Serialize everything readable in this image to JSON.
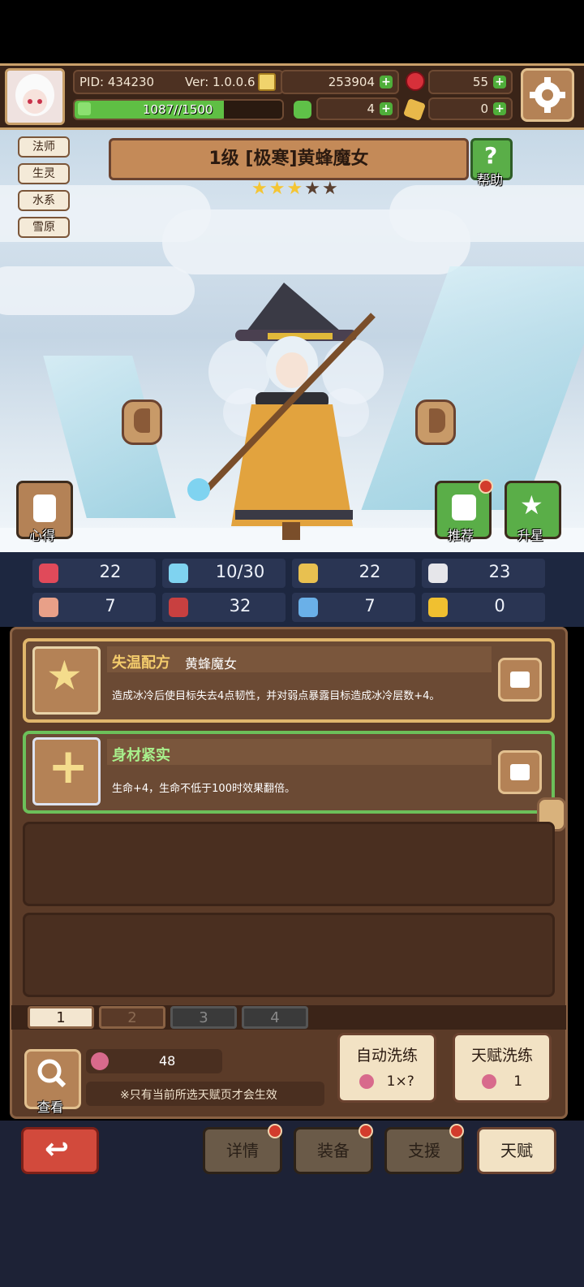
{
  "header": {
    "pid": "PID: 434230",
    "version": "Ver: 1.0.0.6",
    "gold": "253904",
    "gems": "55",
    "clover": "4",
    "dice": "0",
    "exp_text": "1087//1500",
    "exp_fraction": 0.72
  },
  "tags": [
    "法师",
    "生灵",
    "水系",
    "雪原"
  ],
  "title": {
    "name": "1级 [极寒]黄蜂魔女",
    "stars_filled": 3,
    "stars_total": 5,
    "help_label": "帮助"
  },
  "side_buttons": {
    "insight": "心得",
    "recommend": "推荐",
    "star_up": "升星"
  },
  "stats": [
    {
      "icon": "heart-icon",
      "value": "22"
    },
    {
      "icon": "mana-drop-icon",
      "value": "10/30"
    },
    {
      "icon": "shield-icon",
      "value": "22"
    },
    {
      "icon": "wing-icon",
      "value": "23"
    },
    {
      "icon": "fist-icon",
      "value": "7"
    },
    {
      "icon": "book-icon",
      "value": "32"
    },
    {
      "icon": "boot-icon",
      "value": "7"
    },
    {
      "icon": "horseshoe-icon",
      "value": "0"
    }
  ],
  "talents": [
    {
      "name": "失温配方",
      "owner": "黄蜂魔女",
      "description": "造成冰冷后使目标失去4点韧性，并对弱点暴露目标造成冰冷层数+4。"
    },
    {
      "name": "身材紧实",
      "owner": "",
      "description": "生命+4，生命不低于100时效果翻倍。"
    }
  ],
  "pages": [
    "1",
    "2",
    "3",
    "4"
  ],
  "potion_count": "48",
  "notice": "※只有当前所选天赋页才会生效",
  "view_label": "查看",
  "auto_refine": {
    "label": "自动洗练",
    "cost": "1×?"
  },
  "talent_refine": {
    "label": "天赋洗练",
    "cost": "1"
  },
  "nav": [
    "详情",
    "装备",
    "支援",
    "天赋"
  ],
  "colors": {
    "accent_gold": "#c9a06a",
    "green": "#4fae3a",
    "red_dot": "#d23c2c"
  }
}
